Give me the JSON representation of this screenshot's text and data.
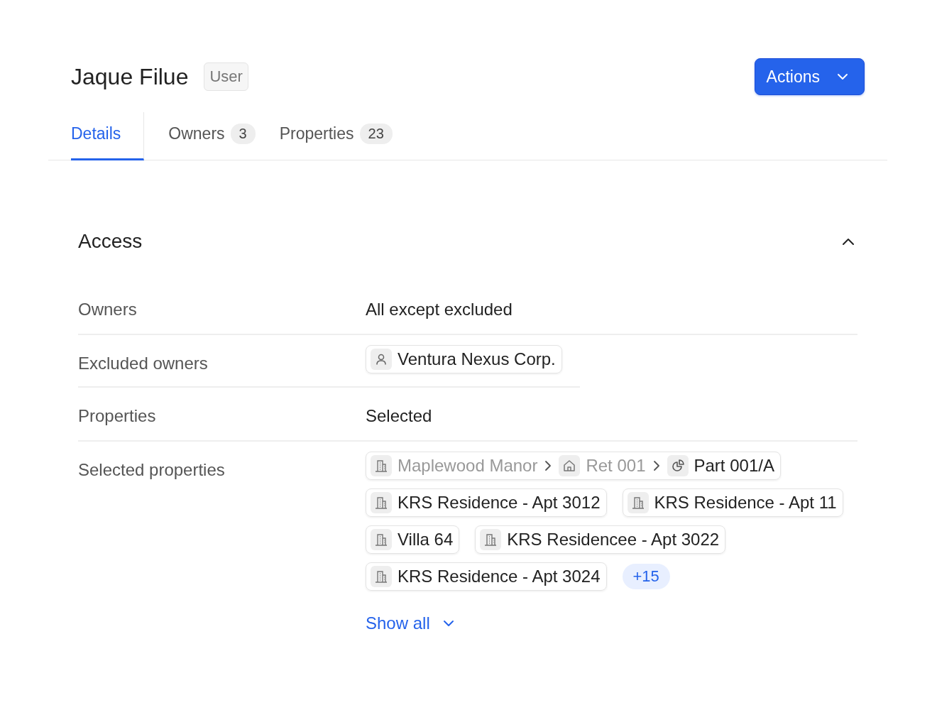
{
  "header": {
    "title": "Jaque Filue",
    "role_badge": "User",
    "actions_button": "Actions"
  },
  "tabs": [
    {
      "label": "Details",
      "selected": true
    },
    {
      "label": "Owners",
      "count": "3",
      "selected": false
    },
    {
      "label": "Properties",
      "count": "23",
      "selected": false
    }
  ],
  "section": {
    "title": "Access",
    "expanded": true,
    "fields": [
      {
        "kind": "text",
        "label": "Owners",
        "value": "All except excluded"
      },
      {
        "kind": "owners",
        "label": "Excluded owners",
        "owners": [
          "Ventura Nexus Corp."
        ]
      },
      {
        "kind": "text",
        "label": "Properties",
        "value": "Selected"
      },
      {
        "kind": "properties",
        "label": "Selected properties",
        "properties": [
          {
            "segments": [
              {
                "kind": "building",
                "label": "Maplewood Manor",
                "muted": true
              },
              {
                "kind": "unit",
                "label": "Ret 001",
                "muted": true
              },
              {
                "kind": "part",
                "label": "Part 001/A",
                "muted": false
              }
            ]
          },
          {
            "segments": [
              {
                "kind": "building",
                "label": "KRS Residence - Apt 3012",
                "muted": false
              }
            ]
          },
          {
            "segments": [
              {
                "kind": "building",
                "label": "KRS Residence - Apt 11",
                "muted": false
              }
            ]
          },
          {
            "segments": [
              {
                "kind": "building",
                "label": "Villa 64",
                "muted": false
              }
            ]
          },
          {
            "segments": [
              {
                "kind": "building",
                "label": "KRS Residencee - Apt 3022",
                "muted": false
              }
            ]
          },
          {
            "segments": [
              {
                "kind": "building",
                "label": "KRS Residence - Apt 3024",
                "muted": false
              }
            ]
          }
        ],
        "more_badge": "+15",
        "show_all_link": "Show all"
      }
    ]
  }
}
